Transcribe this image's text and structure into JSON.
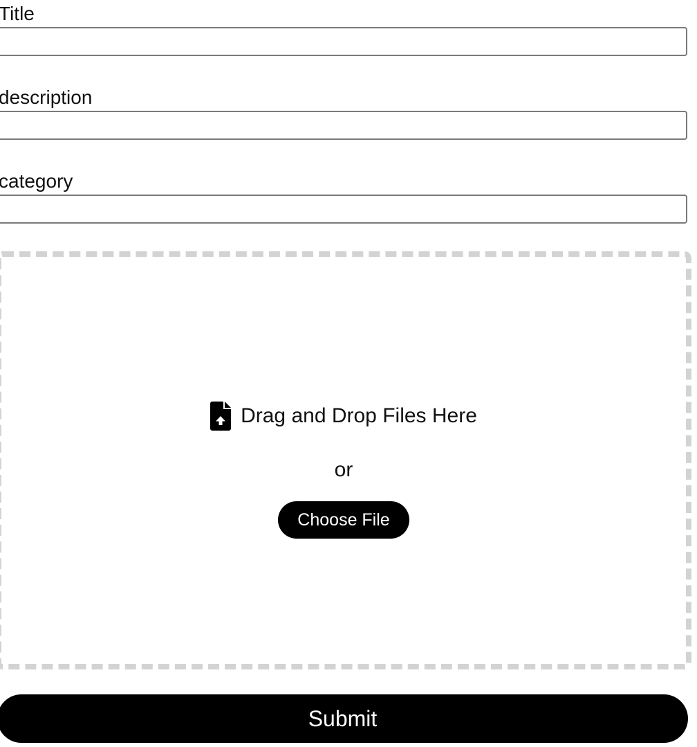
{
  "form": {
    "title": {
      "label": "Title",
      "value": "",
      "placeholder": ""
    },
    "description": {
      "label": "description",
      "value": "",
      "placeholder": ""
    },
    "category": {
      "label": "category",
      "value": "",
      "placeholder": ""
    }
  },
  "dropzone": {
    "icon": "file-upload-icon",
    "drop_text": "Drag and Drop Files Here",
    "or_text": "or",
    "choose_label": "Choose File",
    "border_color": "#d3d3d3"
  },
  "submit": {
    "label": "Submit",
    "background": "#000000",
    "text_color": "#ffffff"
  }
}
